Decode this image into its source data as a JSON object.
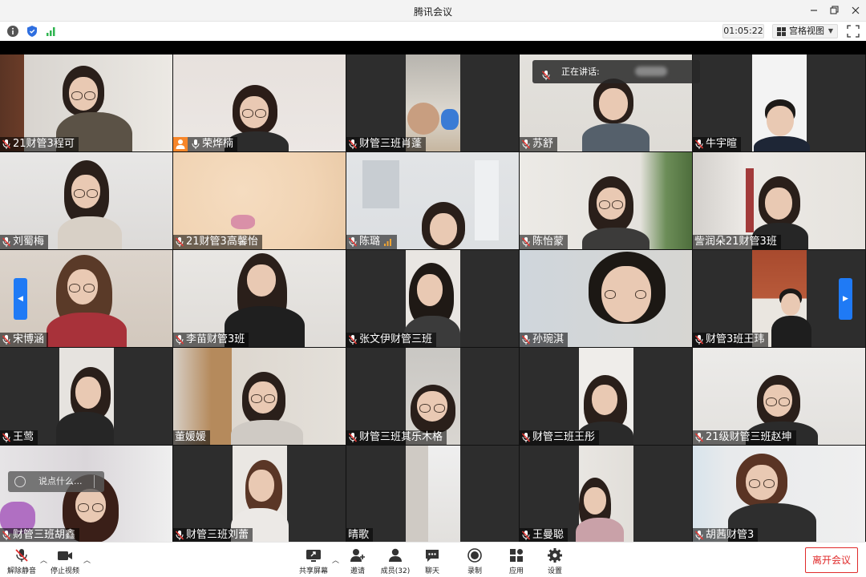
{
  "window": {
    "title": "腾讯会议"
  },
  "status": {
    "timer": "01:05:22",
    "view_label": "宫格视图"
  },
  "speaking": {
    "label": "正在讲话:"
  },
  "chat": {
    "placeholder": "说点什么..."
  },
  "participants": [
    {
      "name": "21财管3程可",
      "muted": true
    },
    {
      "name": "荣烨楠",
      "muted": false,
      "host": true
    },
    {
      "name": "财管三班肖蓬",
      "muted": true
    },
    {
      "name": "苏舒",
      "muted": true
    },
    {
      "name": "牛宇暄",
      "muted": true
    },
    {
      "name": "刘蜀梅",
      "muted": true
    },
    {
      "name": "21财管3高馨怡",
      "muted": true
    },
    {
      "name": "陈璐",
      "muted": true,
      "signal": true
    },
    {
      "name": "陈怡蒙",
      "muted": true
    },
    {
      "name": "訾润朵21财管3班",
      "muted": false
    },
    {
      "name": "宋博涵",
      "muted": true
    },
    {
      "name": "李苗财管3班",
      "muted": true
    },
    {
      "name": "张文伊财管三班",
      "muted": true
    },
    {
      "name": "孙琬淇",
      "muted": true
    },
    {
      "name": "财管3班王玮",
      "muted": true
    },
    {
      "name": "王莺",
      "muted": true
    },
    {
      "name": "董媛媛",
      "muted": false
    },
    {
      "name": "财管三班其乐木格",
      "muted": true
    },
    {
      "name": "财管三班王彤",
      "muted": true
    },
    {
      "name": "21级财管三班赵坤",
      "muted": true
    },
    {
      "name": "财管三班胡鑫",
      "muted": true
    },
    {
      "name": "财管三班刘蕾",
      "muted": true
    },
    {
      "name": "晴歌",
      "muted": false
    },
    {
      "name": "王曼聪",
      "muted": true
    },
    {
      "name": "胡茜财管3",
      "muted": true
    }
  ],
  "toolbar": {
    "unmute": "解除静音",
    "stop_video": "停止视频",
    "share": "共享屏幕",
    "invite": "邀请",
    "members": "成员(32)",
    "chat": "聊天",
    "record": "录制",
    "apps": "应用",
    "settings": "设置",
    "leave": "离开会议"
  },
  "colors": {
    "accent": "#1f7af5",
    "leave": "#e02b2b",
    "host_badge": "#f7862a"
  }
}
